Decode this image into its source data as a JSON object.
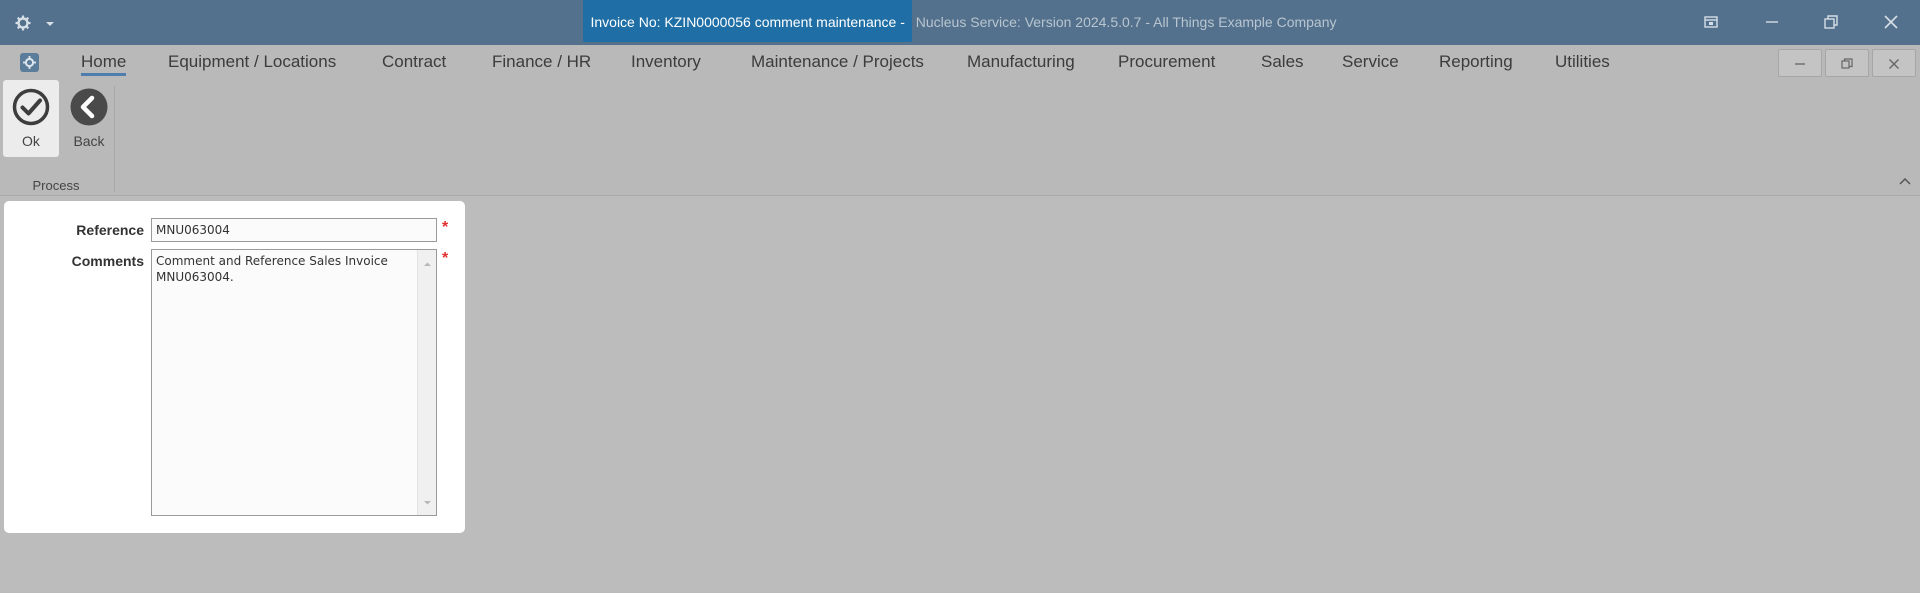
{
  "titlebar": {
    "title_highlight": "Invoice No: KZIN0000056 comment maintenance -",
    "title_rest": " Nucleus Service: Version 2024.5.0.7 - All Things Example Company",
    "icons": [
      "gear-icon",
      "dropdown-icon",
      "layout-icon",
      "minimize-icon",
      "restore-icon",
      "close-icon"
    ]
  },
  "menu": {
    "items": [
      {
        "label": "Home",
        "active": true
      },
      {
        "label": "Equipment / Locations"
      },
      {
        "label": "Contract"
      },
      {
        "label": "Finance / HR"
      },
      {
        "label": "Inventory"
      },
      {
        "label": "Maintenance / Projects"
      },
      {
        "label": "Manufacturing"
      },
      {
        "label": "Procurement"
      },
      {
        "label": "Sales"
      },
      {
        "label": "Service"
      },
      {
        "label": "Reporting"
      },
      {
        "label": "Utilities"
      }
    ],
    "accent": "#4f7eae"
  },
  "ribbon": {
    "ok_label": "Ok",
    "back_label": "Back",
    "group_label": "Process"
  },
  "form": {
    "reference_label": "Reference",
    "reference_value": "MNU063004",
    "comments_label": "Comments",
    "comments_value": "Comment and Reference Sales Invoice\nMNU063004.",
    "required_mark": "*",
    "required_color": "#e03030"
  }
}
